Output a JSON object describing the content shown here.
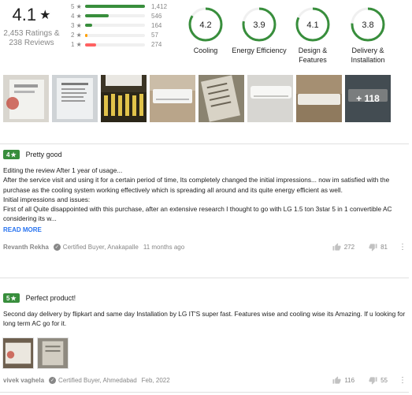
{
  "summary": {
    "rating": "4.1",
    "star": "★",
    "ratings_count": "2,453 Ratings &",
    "reviews_count": "238 Reviews",
    "distribution": [
      {
        "stars": "5 ★",
        "count": "1,412",
        "fraction": 1.0,
        "color": "#388e3c"
      },
      {
        "stars": "4 ★",
        "count": "546",
        "fraction": 0.39,
        "color": "#388e3c"
      },
      {
        "stars": "3 ★",
        "count": "164",
        "fraction": 0.12,
        "color": "#388e3c"
      },
      {
        "stars": "2 ★",
        "count": "57",
        "fraction": 0.04,
        "color": "#ff9f00"
      },
      {
        "stars": "1 ★",
        "count": "274",
        "fraction": 0.19,
        "color": "#ff6161"
      }
    ],
    "aspects": [
      {
        "score": "4.2",
        "value": 0.84,
        "label": "Cooling"
      },
      {
        "score": "3.9",
        "value": 0.78,
        "label": "Energy Efficiency"
      },
      {
        "score": "4.1",
        "value": 0.82,
        "label": "Design & Features"
      },
      {
        "score": "3.8",
        "value": 0.76,
        "label": "Delivery & Installation"
      }
    ]
  },
  "photos": {
    "more_label": "+ 118"
  },
  "reviews": [
    {
      "rating": "4",
      "star": "★",
      "title": "Pretty good",
      "body": "Editing the review After 1 year of usage...\nAfter the service visit and using it for a certain period of time, Its completely changed the initial impressions... now im satisfied with the purchase as the cooling system working effectively which is spreading all around and its quite energy efficient as well.\nInitial impressions and issues:\nFirst of all Quite disappointed with this purchase, after an extensive research I thought to go with LG 1.5 ton 3star 5 in 1 convertible AC considering its w...",
      "read_more": "READ MORE",
      "author": "Revanth Rekha",
      "certified": "Certified Buyer, Anakapalle",
      "time": "11 months ago",
      "likes": "272",
      "dislikes": "81",
      "menu": "⋮"
    },
    {
      "rating": "5",
      "star": "★",
      "title": "Perfect product!",
      "body": "Second day delivery by flipkart and same day Installation by LG IT'S super fast. Features wise and cooling wise its Amazing. If u looking for long term AC go for it.",
      "author": "vivek vaghela",
      "certified": "Certified Buyer, Ahmedabad",
      "time": "Feb, 2022",
      "likes": "116",
      "dislikes": "55",
      "menu": "⋮"
    }
  ],
  "colors": {
    "green": "#388e3c",
    "link": "#2874f0",
    "muted": "#878787"
  }
}
